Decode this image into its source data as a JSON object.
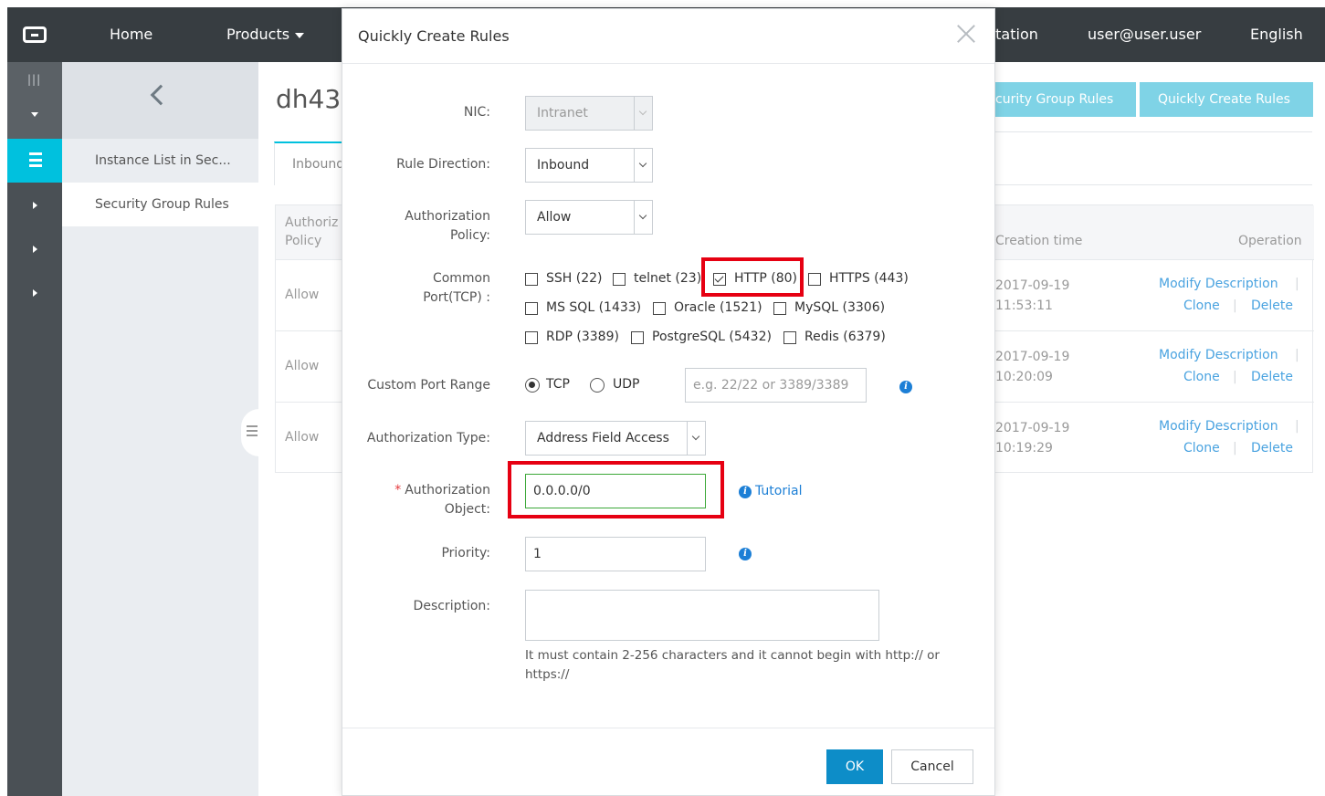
{
  "topbar": {
    "home": "Home",
    "products": "Products",
    "documentation": "ntation",
    "user": "user@user.user",
    "language": "English"
  },
  "subnav": {
    "items": [
      "Instance List in Sec...",
      "Security Group Rules"
    ]
  },
  "main": {
    "title": "dh43",
    "buttons": [
      "curity Group Rules",
      "Quickly Create Rules"
    ],
    "tab": "Inbound",
    "table": {
      "headers": {
        "policy": "Authoriz Policy",
        "creation_time": "Creation time",
        "operation": "Operation"
      },
      "rows": [
        {
          "policy": "Allow",
          "date": "2017-09-19",
          "time": "11:53:11"
        },
        {
          "policy": "Allow",
          "date": "2017-09-19",
          "time": "10:20:09"
        },
        {
          "policy": "Allow",
          "date": "2017-09-19",
          "time": "10:19:29"
        }
      ],
      "ops": {
        "modify": "Modify Description",
        "clone": "Clone",
        "delete": "Delete",
        "sep": "|"
      }
    }
  },
  "modal": {
    "title": "Quickly Create Rules",
    "nic": {
      "label": "NIC:",
      "value": "Intranet"
    },
    "direction": {
      "label": "Rule Direction:",
      "value": "Inbound"
    },
    "policy": {
      "label_1": "Authorization",
      "label_2": "Policy:",
      "value": "Allow"
    },
    "ports": {
      "label_1": "Common",
      "label_2": "Port(TCP) :",
      "items": [
        {
          "label": "SSH (22)",
          "checked": false
        },
        {
          "label": "telnet (23)",
          "checked": false
        },
        {
          "label": "HTTP (80)",
          "checked": true
        },
        {
          "label": "HTTPS (443)",
          "checked": false
        },
        {
          "label": "MS SQL (1433)",
          "checked": false
        },
        {
          "label": "Oracle (1521)",
          "checked": false
        },
        {
          "label": "MySQL (3306)",
          "checked": false
        },
        {
          "label": "RDP (3389)",
          "checked": false
        },
        {
          "label": "PostgreSQL (5432)",
          "checked": false
        },
        {
          "label": "Redis (6379)",
          "checked": false
        }
      ]
    },
    "custom_port": {
      "label": "Custom Port Range",
      "tcp": "TCP",
      "udp": "UDP",
      "selected": "TCP",
      "placeholder": "e.g. 22/22 or 3389/3389"
    },
    "auth_type": {
      "label": "Authorization Type:",
      "value": "Address Field Access"
    },
    "auth_object": {
      "required": "*",
      "label_1": "Authorization",
      "label_2": "Object:",
      "value": "0.0.0.0/0",
      "tutorial": "Tutorial"
    },
    "priority": {
      "label": "Priority:",
      "value": "1"
    },
    "description": {
      "label": "Description:",
      "help": "It must contain 2-256 characters and it cannot begin with http:// or https://"
    },
    "ok": "OK",
    "cancel": "Cancel"
  },
  "colors": {
    "topbar": "#373d41",
    "accent": "#00c1de",
    "primary_button": "#0d8dc8",
    "highlight": "#e60012",
    "link": "#1c7fd6"
  },
  "icons": {
    "logo": "logo-icon",
    "close": "close-icon",
    "back": "chevron-left-icon",
    "info": "info-icon"
  }
}
